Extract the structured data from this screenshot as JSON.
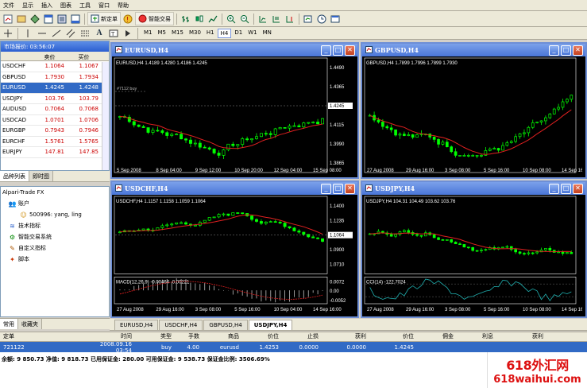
{
  "menu": [
    "文件",
    "显示",
    "插入",
    "图表",
    "工具",
    "窗口",
    "帮助"
  ],
  "toolbar": {
    "new_order": "新定单",
    "experts": "智能交易"
  },
  "timeframes": [
    "M1",
    "M5",
    "M15",
    "M30",
    "H1",
    "H4",
    "D1",
    "W1",
    "MN"
  ],
  "active_timeframe": "H4",
  "market_watch": {
    "title": "市场报价: 03:56:07",
    "col_symbol": "",
    "col_bid": "卖价",
    "col_ask": "买价",
    "rows": [
      {
        "symbol": "USDCHF",
        "bid": "1.1064",
        "ask": "1.1067"
      },
      {
        "symbol": "GBPUSD",
        "bid": "1.7930",
        "ask": "1.7934"
      },
      {
        "symbol": "EURUSD",
        "bid": "1.4245",
        "ask": "1.4248",
        "selected": true
      },
      {
        "symbol": "USDJPY",
        "bid": "103.76",
        "ask": "103.79"
      },
      {
        "symbol": "AUDUSD",
        "bid": "0.7064",
        "ask": "0.7068"
      },
      {
        "symbol": "USDCAD",
        "bid": "1.0701",
        "ask": "1.0706"
      },
      {
        "symbol": "EURGBP",
        "bid": "0.7943",
        "ask": "0.7946"
      },
      {
        "symbol": "EURCHF",
        "bid": "1.5761",
        "ask": "1.5765"
      },
      {
        "symbol": "EURJPY",
        "bid": "147.81",
        "ask": "147.85"
      }
    ],
    "tabs": [
      "品种列表",
      "即时图"
    ]
  },
  "navigator": {
    "root": "Alpari-Trade FX",
    "items": [
      {
        "label": "账户",
        "icon": "accounts-icon"
      },
      {
        "label": "500996: yang, ling",
        "icon": "user-icon"
      },
      {
        "label": "技术指标",
        "icon": "indicators-icon"
      },
      {
        "label": "智能交易系统",
        "icon": "experts-icon"
      },
      {
        "label": "自定义指标",
        "icon": "custom-indicators-icon"
      },
      {
        "label": "脚本",
        "icon": "scripts-icon"
      }
    ],
    "tabs": [
      "常用",
      "收藏夹"
    ]
  },
  "charts": [
    {
      "title": "EURUSD,H4",
      "info": "EURUSD,H4  1.4189  1.4280  1.4186  1.4245",
      "prices": [
        "1.4490",
        "1.4365",
        "1.4245",
        "1.4115",
        "1.3990",
        "1.3865"
      ],
      "current": "1.4245",
      "dates": [
        "5 Sep 2008",
        "8 Sep 04:00",
        "9 Sep 12:00",
        "10 Sep 20:00",
        "12 Sep 04:00",
        "15 Sep 08:00"
      ],
      "annotation": "#7112 buy"
    },
    {
      "title": "GBPUSD,H4",
      "info": "GBPUSD,H4  1.7899  1.7996  1.7899  1.7930",
      "prices": [],
      "dates": [
        "27 Aug 2008",
        "29 Aug 16:00",
        "3 Sep 08:00",
        "5 Sep 16:00",
        "10 Sep 08:00",
        "14 Sep 16:00"
      ]
    },
    {
      "title": "USDCHF,H4",
      "info": "USDCHF,H4  1.1157  1.1158  1.1059  1.1064",
      "prices": [
        "1.1400",
        "1.1235",
        "1.1064",
        "1.0900",
        "1.0710"
      ],
      "current": "1.1064",
      "macd_label": "MACD(12,26,9)  -0.00464  -0.00221",
      "macd_prices": [
        "0.0072",
        "0.00",
        "-0.0052"
      ],
      "dates": [
        "27 Aug 2008",
        "29 Aug 16:00",
        "3 Sep 08:00",
        "5 Sep 16:00",
        "10 Sep 04:00",
        "14 Sep 16:00"
      ]
    },
    {
      "title": "USDJPY,H4",
      "info": "USDJPY,H4  104.31  104.49  103.62  103.76",
      "cci_label": "CCI(14)  -122.7024",
      "dates": [
        "27 Aug 2008",
        "29 Aug 16:00",
        "3 Sep 08:00",
        "5 Sep 16:00",
        "10 Sep 08:00",
        "14 Sep 16:00"
      ]
    }
  ],
  "chart_tabs": [
    "EURUSD,H4",
    "USDCHF,H4",
    "GBPUSD,H4",
    "USDJPY,H4"
  ],
  "active_chart_tab": "USDJPY,H4",
  "terminal": {
    "headers": [
      "定单",
      "时间",
      "类型",
      "手数",
      "商品",
      "价位",
      "止损",
      "获利",
      "价位",
      "佣金",
      "利息",
      "获利"
    ],
    "row": [
      "721122",
      "2008.09.16 03:54",
      "buy",
      "4.00",
      "eurusd",
      "1.4253",
      "0.0000",
      "0.0000",
      "1.4245",
      "",
      "",
      ""
    ],
    "balance": "余额: 9 850.73  净值: 9 818.73  已用保证金: 280.00  可用保证金: 9 538.73  保证金比例: 3506.69%"
  },
  "watermark": {
    "line1": "618外汇网",
    "line2": "618waihui.com"
  },
  "colors": {
    "bull": "#00ff00",
    "ma": "#ff0000",
    "title_bar": "#4a76d8",
    "selection": "#316ac5"
  }
}
